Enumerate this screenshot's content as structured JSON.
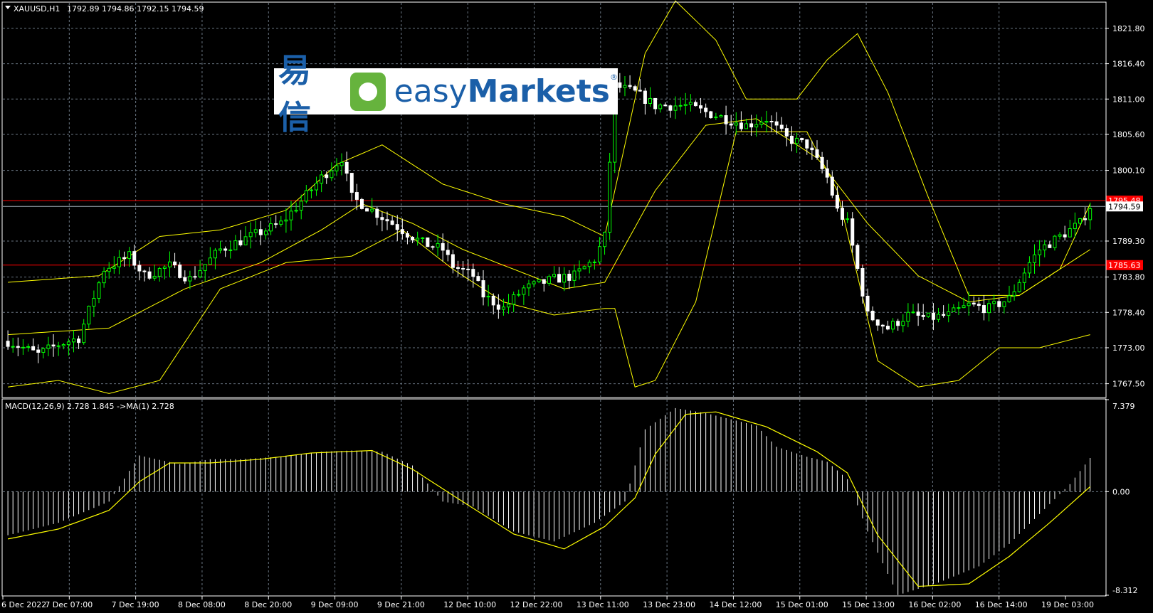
{
  "header": {
    "symbol": "XAUUSD,H1",
    "ohlc": "1792.89 1794.86 1792.15 1794.59"
  },
  "macd_header": "MACD(12,26,9) 2.728 1.845  ->MA(1) 2.728",
  "logo": {
    "cn": "易信",
    "en_light": "easy",
    "en_bold": "Markets",
    "reg": "®"
  },
  "colors": {
    "background": "#000000",
    "bull": "#00ff00",
    "bear": "#ffffff",
    "band": "#ffff00",
    "grid": "#6a7682",
    "hline": "#ff0000",
    "axis_text": "#ffffff"
  },
  "chart_data": {
    "type": "candlestick",
    "symbol": "XAUUSD",
    "timeframe": "H1",
    "price_axis": {
      "ticks": [
        "1821.80",
        "1816.40",
        "1811.00",
        "1805.60",
        "1800.10",
        "1794.59",
        "1789.30",
        "1783.80",
        "1778.40",
        "1773.00",
        "1767.50"
      ],
      "ylim": [
        1765.5,
        1825.7
      ]
    },
    "time_axis": {
      "labels": [
        "6 Dec 2022",
        "7 Dec 07:00",
        "7 Dec 19:00",
        "8 Dec 08:00",
        "8 Dec 20:00",
        "9 Dec 09:00",
        "9 Dec 21:00",
        "12 Dec 10:00",
        "12 Dec 22:00",
        "13 Dec 11:00",
        "13 Dec 23:00",
        "14 Dec 12:00",
        "15 Dec 01:00",
        "15 Dec 13:00",
        "16 Dec 02:00",
        "16 Dec 14:00",
        "19 Dec 03:00"
      ]
    },
    "current_price": "1794.59",
    "horizontal_lines": [
      {
        "price": 1795.48,
        "label": "1795.48"
      },
      {
        "price": 1785.63,
        "label": "1785.63"
      }
    ],
    "close_path": [
      [
        0,
        1774
      ],
      [
        6,
        1772
      ],
      [
        10,
        1773.5
      ],
      [
        14,
        1774.5
      ],
      [
        19,
        1785
      ],
      [
        24,
        1787
      ],
      [
        27,
        1784
      ],
      [
        32,
        1785.5
      ],
      [
        36,
        1783.5
      ],
      [
        42,
        1788
      ],
      [
        48,
        1790
      ],
      [
        54,
        1792
      ],
      [
        57,
        1794.5
      ],
      [
        62,
        1799
      ],
      [
        66,
        1802
      ],
      [
        68,
        1796
      ],
      [
        72,
        1794
      ],
      [
        78,
        1791
      ],
      [
        82,
        1789
      ],
      [
        86,
        1788
      ],
      [
        88,
        1785.5
      ],
      [
        92,
        1784
      ],
      [
        94,
        1781
      ],
      [
        98,
        1779
      ],
      [
        102,
        1782
      ],
      [
        108,
        1783.5
      ],
      [
        112,
        1784
      ],
      [
        116,
        1786.5
      ],
      [
        118,
        1790
      ],
      [
        120,
        1813
      ],
      [
        124,
        1812
      ],
      [
        128,
        1810
      ],
      [
        134,
        1810
      ],
      [
        138,
        1809
      ],
      [
        142,
        1808
      ],
      [
        146,
        1807
      ],
      [
        150,
        1808
      ],
      [
        154,
        1805
      ],
      [
        158,
        1804
      ],
      [
        162,
        1799
      ],
      [
        164,
        1794
      ],
      [
        166,
        1792
      ],
      [
        170,
        1778
      ],
      [
        174,
        1776
      ],
      [
        178,
        1778
      ],
      [
        182,
        1777.5
      ],
      [
        186,
        1778
      ],
      [
        190,
        1779.5
      ],
      [
        194,
        1779
      ],
      [
        198,
        1780.5
      ],
      [
        202,
        1786
      ],
      [
        204,
        1788
      ],
      [
        208,
        1790
      ],
      [
        212,
        1792
      ],
      [
        214,
        1794.6
      ]
    ],
    "bollinger_bands": {
      "middle": [
        [
          0,
          1775
        ],
        [
          20,
          1776
        ],
        [
          35,
          1782
        ],
        [
          50,
          1786
        ],
        [
          62,
          1791
        ],
        [
          70,
          1795
        ],
        [
          80,
          1792
        ],
        [
          90,
          1788
        ],
        [
          100,
          1785
        ],
        [
          110,
          1782
        ],
        [
          118,
          1783
        ],
        [
          128,
          1797
        ],
        [
          138,
          1807
        ],
        [
          148,
          1808
        ],
        [
          160,
          1802
        ],
        [
          170,
          1792
        ],
        [
          180,
          1784
        ],
        [
          190,
          1780
        ],
        [
          200,
          1781
        ],
        [
          210,
          1786
        ],
        [
          214,
          1788
        ]
      ],
      "upper": [
        [
          0,
          1783
        ],
        [
          18,
          1784
        ],
        [
          30,
          1790
        ],
        [
          42,
          1791
        ],
        [
          55,
          1794
        ],
        [
          65,
          1801
        ],
        [
          74,
          1804
        ],
        [
          86,
          1798
        ],
        [
          98,
          1795
        ],
        [
          110,
          1793
        ],
        [
          118,
          1790
        ],
        [
          122,
          1804
        ],
        [
          126,
          1818
        ],
        [
          132,
          1826
        ],
        [
          140,
          1820
        ],
        [
          146,
          1811
        ],
        [
          156,
          1811
        ],
        [
          162,
          1817
        ],
        [
          168,
          1821
        ],
        [
          174,
          1812
        ],
        [
          182,
          1796
        ],
        [
          190,
          1781
        ],
        [
          200,
          1781
        ],
        [
          208,
          1785
        ],
        [
          214,
          1795
        ]
      ],
      "lower": [
        [
          0,
          1767
        ],
        [
          10,
          1768
        ],
        [
          20,
          1766
        ],
        [
          30,
          1768
        ],
        [
          42,
          1782
        ],
        [
          55,
          1786
        ],
        [
          68,
          1787
        ],
        [
          78,
          1791
        ],
        [
          88,
          1785
        ],
        [
          98,
          1780
        ],
        [
          108,
          1778
        ],
        [
          118,
          1779
        ],
        [
          120,
          1779
        ],
        [
          124,
          1767
        ],
        [
          128,
          1768
        ],
        [
          136,
          1780
        ],
        [
          144,
          1806
        ],
        [
          158,
          1806
        ],
        [
          164,
          1797
        ],
        [
          172,
          1771
        ],
        [
          180,
          1767
        ],
        [
          188,
          1768
        ],
        [
          196,
          1773
        ],
        [
          204,
          1773
        ],
        [
          214,
          1775
        ]
      ]
    },
    "macd": {
      "ylim": [
        -8.312,
        7.379
      ],
      "ticks": [
        "7.379",
        "0.00",
        "-8.312"
      ],
      "histogram_path": [
        [
          0,
          -3.5
        ],
        [
          10,
          -2.5
        ],
        [
          20,
          -0.8
        ],
        [
          26,
          2.9
        ],
        [
          34,
          2.2
        ],
        [
          40,
          2.6
        ],
        [
          46,
          2.6
        ],
        [
          54,
          2.8
        ],
        [
          62,
          3.2
        ],
        [
          68,
          3.3
        ],
        [
          74,
          3.2
        ],
        [
          80,
          2.1
        ],
        [
          86,
          -0.8
        ],
        [
          92,
          -1.2
        ],
        [
          100,
          -3.2
        ],
        [
          108,
          -4.0
        ],
        [
          116,
          -2.5
        ],
        [
          122,
          -0.8
        ],
        [
          126,
          5.0
        ],
        [
          132,
          6.7
        ],
        [
          138,
          6.3
        ],
        [
          148,
          5.3
        ],
        [
          152,
          3.6
        ],
        [
          158,
          2.8
        ],
        [
          162,
          2.4
        ],
        [
          166,
          1.0
        ],
        [
          170,
          -3.2
        ],
        [
          176,
          -8.3
        ],
        [
          184,
          -7.3
        ],
        [
          192,
          -6.0
        ],
        [
          198,
          -4.2
        ],
        [
          204,
          -1.8
        ],
        [
          210,
          0.6
        ],
        [
          214,
          2.7
        ]
      ],
      "signal_path": [
        [
          0,
          -3.8
        ],
        [
          10,
          -3.0
        ],
        [
          20,
          -1.5
        ],
        [
          26,
          0.8
        ],
        [
          32,
          2.3
        ],
        [
          40,
          2.3
        ],
        [
          50,
          2.6
        ],
        [
          60,
          3.1
        ],
        [
          72,
          3.3
        ],
        [
          80,
          1.8
        ],
        [
          88,
          -0.3
        ],
        [
          100,
          -3.4
        ],
        [
          110,
          -4.6
        ],
        [
          118,
          -2.8
        ],
        [
          124,
          -0.5
        ],
        [
          128,
          3.0
        ],
        [
          134,
          6.2
        ],
        [
          140,
          6.4
        ],
        [
          150,
          5.2
        ],
        [
          160,
          3.2
        ],
        [
          166,
          1.5
        ],
        [
          172,
          -3.5
        ],
        [
          180,
          -7.6
        ],
        [
          190,
          -7.4
        ],
        [
          198,
          -5.2
        ],
        [
          206,
          -2.5
        ],
        [
          214,
          0.4
        ]
      ]
    }
  }
}
